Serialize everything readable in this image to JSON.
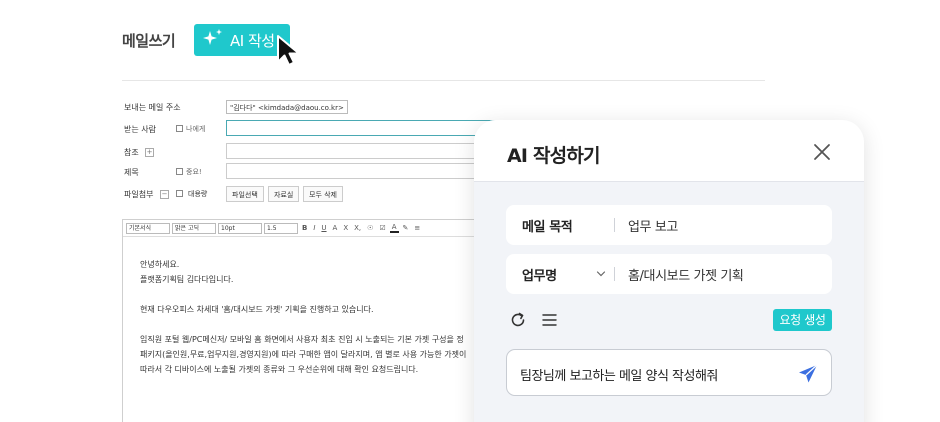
{
  "compose": {
    "title": "메일쓰기",
    "ai_button_label": "AI 작성",
    "sender_label": "보내는 메일 주소",
    "sender_value": "\"김다다\" <kimdada@daou.co.kr>",
    "to_label": "받는 사람",
    "to_self_label": "나에게",
    "cc_label": "참조",
    "subject_label": "제목",
    "important_label": "중요!",
    "attach_label": "파일첨부",
    "bulk_label": "대용량",
    "attach_buttons": [
      "파일선택",
      "자료실",
      "모두 삭제"
    ]
  },
  "editor": {
    "toolbar": {
      "style_select": "기본서식",
      "font_select": "맑은 고딕",
      "size_select": "10pt",
      "line_select": "1.5",
      "format_buttons": [
        "B",
        "I",
        "U",
        "A",
        "X",
        "X,",
        "☉",
        "☑"
      ]
    },
    "body_lines": [
      "안녕하세요.",
      "플랫폼기획팀 김다다입니다.",
      "",
      "현재 다우오피스 차세대 '홈/대시보드 가젯' 기획을 진행하고 있습니다.",
      "",
      "임직원 포털 웹/PC메신저/ 모바일 홈 화면에서 사용자 최초 진입 시 노출되는 기본 가젯 구성을 정",
      "패키지(올인원,무료,업무지원,경영지원)에 따라 구매한 앱이 달라지며, 앱 별로 사용 가능한 가젯이",
      "따라서 각 디바이스에 노출될 가젯의 종류와 그 우선순위에 대해 확인 요청드립니다."
    ]
  },
  "ai_panel": {
    "title": "AI 작성하기",
    "purpose_label": "메일 목적",
    "purpose_value": "업무 보고",
    "task_label": "업무명",
    "task_value": "홈/대시보드 가젯 기획",
    "request_button": "요청 생성",
    "prompt_text": "팀장님께 보고하는 메일 양식 작성해줘"
  },
  "colors": {
    "accent": "#1fc8cc",
    "send_icon": "#3b6fe0"
  },
  "icons": [
    "sparkle-icon",
    "cursor-icon",
    "close-icon",
    "chevron-down-icon",
    "refresh-icon",
    "menu-icon",
    "send-icon"
  ]
}
